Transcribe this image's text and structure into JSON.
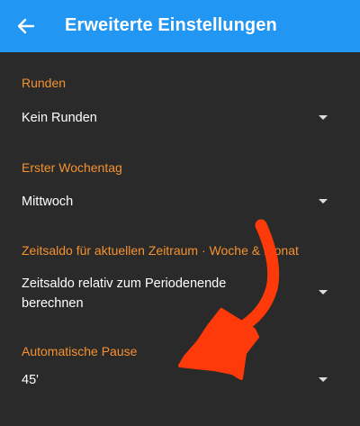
{
  "appbar": {
    "title": "Erweiterte Einstellungen",
    "back_icon": "arrow-left-icon",
    "color": "#2196f3"
  },
  "accent_color": "#f5922f",
  "annotation_color": "#ff3a0a",
  "settings": [
    {
      "label": "Runden",
      "value": "Kein Runden"
    },
    {
      "label": "Erster Wochentag",
      "value": "Mittwoch"
    },
    {
      "label": "Zeitsaldo für aktuellen Zeitraum · Woche & Monat",
      "value_line1": "Zeitsaldo relativ zum Periodenende",
      "value_line2": "berechnen"
    },
    {
      "label": "Automatische Pause",
      "value": "45'"
    }
  ]
}
